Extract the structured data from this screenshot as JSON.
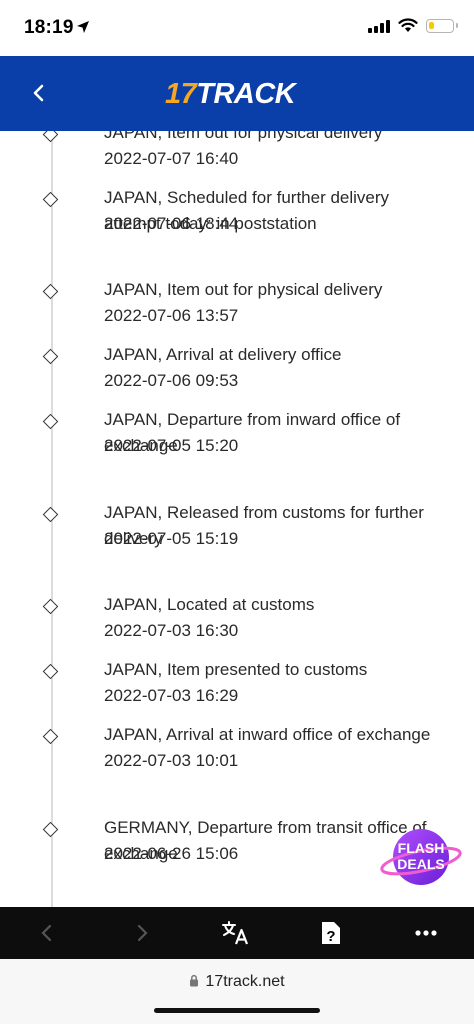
{
  "status_bar": {
    "time": "18:19",
    "battery_color": "#f5cc00",
    "battery_level": 0.25
  },
  "header": {
    "logo_number": "17",
    "logo_word": "TRACK",
    "background_color": "#0a3ea8",
    "accent_color": "#f5a623",
    "back_icon": "chevron-left-icon"
  },
  "events": [
    {
      "description": "JAPAN, Item out for physical delivery",
      "time": "2022-07-07 16:40"
    },
    {
      "description": "JAPAN, Scheduled for further delivery attempt today: in poststation",
      "time": "2022-07-06 18:44"
    },
    {
      "description": "JAPAN, Item out for physical delivery",
      "time": "2022-07-06 13:57"
    },
    {
      "description": "JAPAN, Arrival at delivery office",
      "time": "2022-07-06 09:53"
    },
    {
      "description": "JAPAN, Departure from inward office of exchange",
      "time": "2022-07-05 15:20"
    },
    {
      "description": "JAPAN, Released from customs for further delivery",
      "time": "2022-07-05 15:19"
    },
    {
      "description": "JAPAN, Located at customs",
      "time": "2022-07-03 16:30"
    },
    {
      "description": "JAPAN, Item presented to customs",
      "time": "2022-07-03 16:29"
    },
    {
      "description": "JAPAN, Arrival at inward office of exchange",
      "time": "2022-07-03 10:01"
    },
    {
      "description": "GERMANY, Departure from transit office of exchange",
      "time": "2022-06-26 15:06"
    }
  ],
  "flash_badge": {
    "line1": "FLASH",
    "line2": "DEALS"
  },
  "toolbar": {
    "back_icon": "chevron-left-icon",
    "forward_icon": "chevron-right-icon",
    "translate_icon": "translate-icon",
    "help_icon": "question-icon",
    "more_icon": "more-dots-icon"
  },
  "url_bar": {
    "url": "17track.net",
    "lock_icon": "lock-icon"
  }
}
